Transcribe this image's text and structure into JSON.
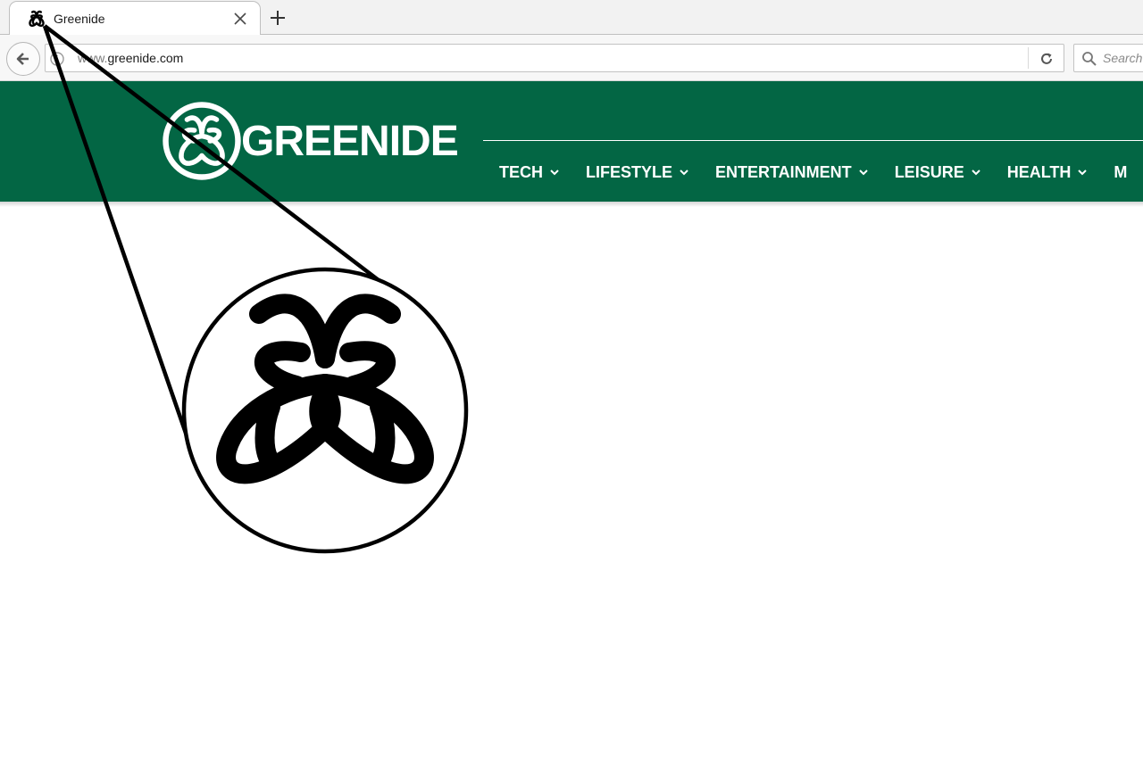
{
  "browser": {
    "tab": {
      "title": "Greenide",
      "favicon": "butterfly-logo-icon",
      "close_icon": "close-icon"
    },
    "new_tab_icon": "plus-icon",
    "back_icon": "back-arrow-icon",
    "address": {
      "url_prefix": "www.",
      "url_domain": "greenide.com",
      "reload_icon": "reload-icon"
    },
    "search": {
      "placeholder": "Search",
      "icon": "search-icon"
    }
  },
  "site": {
    "brand": {
      "name": "GREENIDE",
      "logo_icon": "butterfly-logo-icon"
    },
    "colors": {
      "header_bg": "#036644",
      "header_text": "#ffffff"
    },
    "nav": [
      {
        "label": "TECH"
      },
      {
        "label": "LIFESTYLE"
      },
      {
        "label": "ENTERTAINMENT"
      },
      {
        "label": "LEISURE"
      },
      {
        "label": "HEALTH"
      },
      {
        "label": "M"
      }
    ]
  },
  "callout": {
    "subject": "magnified-favicon",
    "icon": "butterfly-logo-icon"
  }
}
